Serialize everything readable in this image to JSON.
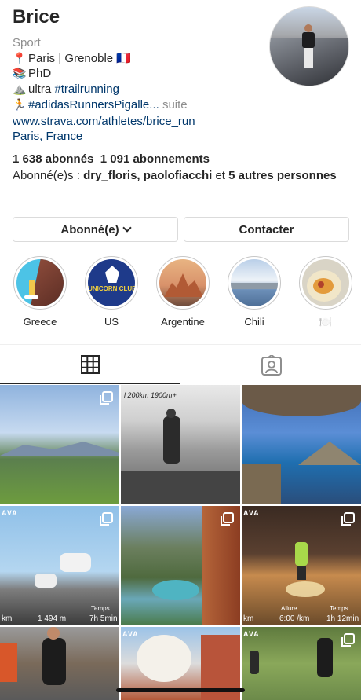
{
  "profile": {
    "username": "Brice",
    "category": "Sport",
    "bio": [
      {
        "emoji": "📍",
        "text": "Paris | Grenoble 🇫🇷"
      },
      {
        "emoji": "📚",
        "text": "PhD"
      },
      {
        "emoji": "⛰️",
        "text": "ultra ",
        "hashtag": "#trailrunning"
      },
      {
        "emoji": "🏃",
        "text": "",
        "hashtag": "#adidasRunnersPigalle...",
        "more": " suite"
      }
    ],
    "website": "www.strava.com/athletes/brice_run",
    "location": "Paris, France",
    "followers_count": "1 638",
    "followers_label": "abonnés",
    "following_count": "1 091",
    "following_label": "abonnements",
    "followed_by_prefix": "Abonné(e)s : ",
    "followed_by_names": "dry_floris, paolofiacchi",
    "followed_by_and": " et ",
    "followed_by_others": "5 autres personnes"
  },
  "buttons": {
    "following": "Abonné(e)",
    "contact": "Contacter"
  },
  "highlights": [
    {
      "label": "Greece"
    },
    {
      "label": "US"
    },
    {
      "label": "Argentine"
    },
    {
      "label": "Chili"
    },
    {
      "label": "🍽️"
    }
  ],
  "highlight_texts": {
    "unicorn_club": "UNICORN CLUB"
  },
  "tabs": {
    "grid": "grid-icon",
    "tagged": "tagged-person-icon"
  },
  "posts": {
    "p2_caption": "l 200km 1900m+",
    "p4_label": "AVA",
    "p4_dplus": "1 494 m",
    "p4_time_label": "Temps",
    "p4_time": "7h 5min",
    "p4_km": "km",
    "p6_label": "AVA",
    "p6_dist_label": "Allure",
    "p6_dist": "6:00 /km",
    "p6_time_label": "Temps",
    "p6_time": "1h 12min",
    "p6_km": "km",
    "p8_label": "AVA",
    "p9_label": "AVA"
  },
  "colors": {
    "link": "#00376b",
    "muted": "#8e8e8e",
    "text": "#262626",
    "border": "#dbdbdb"
  }
}
